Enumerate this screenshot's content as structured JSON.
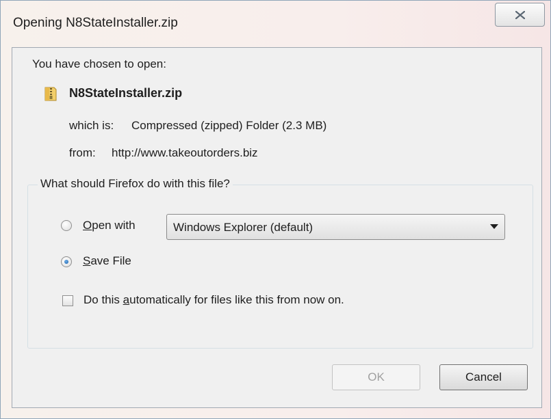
{
  "window": {
    "title": "Opening N8StateInstaller.zip",
    "close_icon": "close-icon"
  },
  "header": {
    "chosen_text": "You have chosen to open:",
    "file_icon": "zip-folder-icon",
    "filename": "N8StateInstaller.zip",
    "which_label": "which is:",
    "which_value": "Compressed (zipped) Folder (2.3 MB)",
    "from_label": "from:",
    "from_value": "http://www.takeoutorders.biz"
  },
  "action_group": {
    "legend": "What should Firefox do with this file?",
    "open_with": {
      "label_mnemonic": "O",
      "label_rest": "pen with",
      "selected": false,
      "select_value": "Windows Explorer (default)"
    },
    "save_file": {
      "label_mnemonic": "S",
      "label_rest": "ave File",
      "selected": true
    },
    "auto": {
      "label_before": "Do this ",
      "label_mnemonic": "a",
      "label_after": "utomatically for files like this from now on.",
      "checked": false
    }
  },
  "buttons": {
    "ok_label": "OK",
    "ok_enabled": false,
    "cancel_label": "Cancel"
  },
  "colors": {
    "accent_radio": "#1b5fa8",
    "window_border": "#8fa5b8",
    "client_background": "#f0f0f0"
  }
}
